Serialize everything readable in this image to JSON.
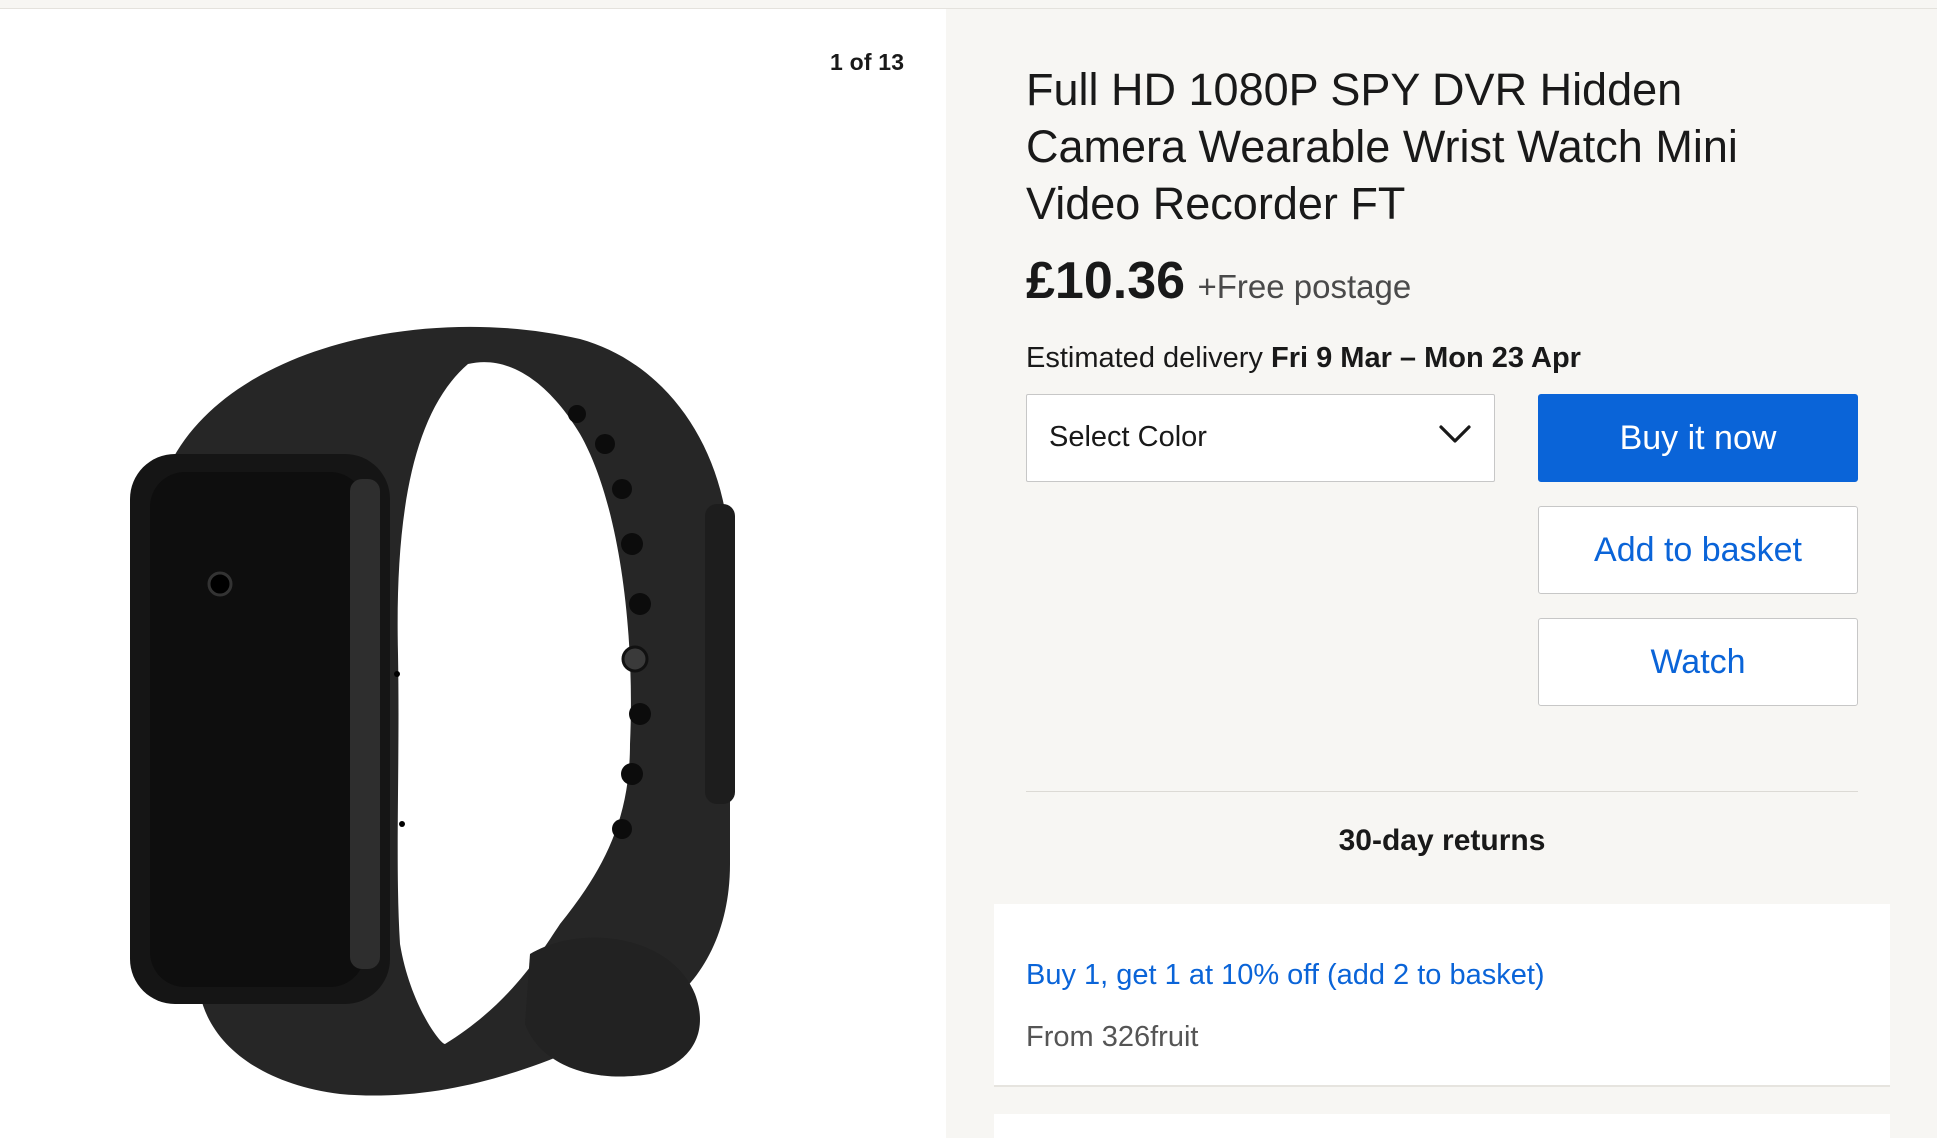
{
  "gallery": {
    "counter": "1 of 13",
    "image_alt": "Black wristband spy camera watch"
  },
  "product": {
    "title": "Full HD 1080P SPY DVR Hidden Camera Wearable Wrist Watch Mini Video Recorder FT",
    "price": "£10.36",
    "postage": "+Free postage",
    "delivery_label": "Estimated delivery",
    "delivery_dates": "Fri 9 Mar – Mon 23 Apr"
  },
  "variant_select": {
    "value": "Select Color",
    "icon": "chevron-down-icon"
  },
  "actions": {
    "buy_now": "Buy it now",
    "add_to_basket": "Add to basket",
    "watch": "Watch"
  },
  "returns": "30-day returns",
  "promotion": {
    "offer": "Buy 1, get 1 at 10% off (add 2 to basket)",
    "seller": "From 326fruit"
  },
  "colors": {
    "accent": "#0a64d8",
    "background": "#f7f6f3",
    "card": "#ffffff"
  }
}
